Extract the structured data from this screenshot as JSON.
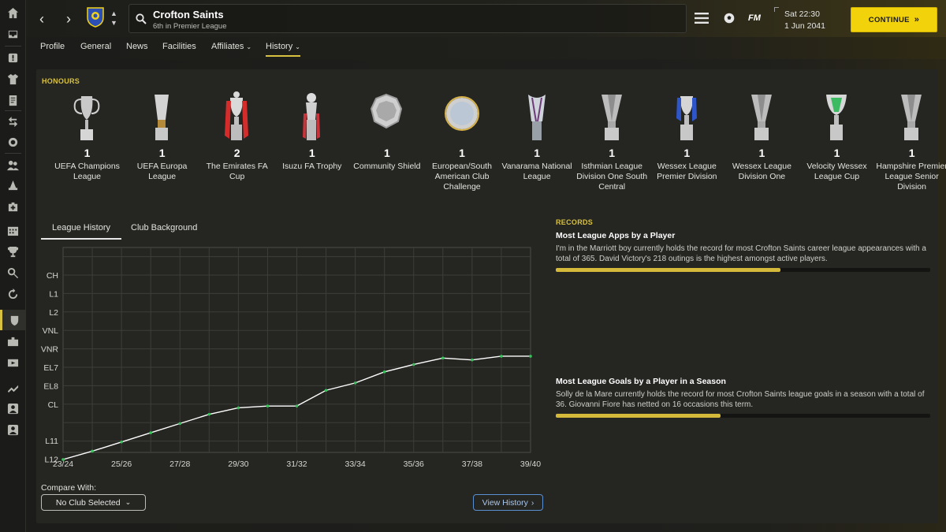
{
  "sidebar": {
    "icons": [
      "home-icon",
      "inbox-icon",
      "alert-icon",
      "squad-icon",
      "tactics-icon",
      "transfers-icon",
      "scouting-icon",
      "staff-icon",
      "training-icon",
      "medical-icon",
      "schedule-icon",
      "competitions-icon",
      "search-icon",
      "refresh-icon",
      "club-icon",
      "finances-icon",
      "media-icon",
      "development-icon",
      "team-report-icon",
      "reserves-icon"
    ]
  },
  "topbar": {
    "club_name": "Crofton Saints",
    "club_position": "6th in Premier League",
    "fm_logo": "FM",
    "day_time": "Sat 22:30",
    "date": "1 Jun 2041",
    "continue_label": "CONTINUE",
    "continue_chevron": "»"
  },
  "tabs": [
    {
      "label": "Profile"
    },
    {
      "label": "General"
    },
    {
      "label": "News"
    },
    {
      "label": "Facilities"
    },
    {
      "label": "Affiliates",
      "has_caret": true
    },
    {
      "label": "History",
      "has_caret": true,
      "active": true
    }
  ],
  "honours": {
    "title": "HONOURS",
    "items": [
      {
        "count": "1",
        "name": "UEFA Champions League",
        "trophy": "cup-big-ears"
      },
      {
        "count": "1",
        "name": "UEFA Europa League",
        "trophy": "cup-europa"
      },
      {
        "count": "2",
        "name": "The Emirates FA Cup",
        "trophy": "cup-fa-ribbons"
      },
      {
        "count": "1",
        "name": "Isuzu FA Trophy",
        "trophy": "cup-ribbons-small"
      },
      {
        "count": "1",
        "name": "Community Shield",
        "trophy": "shield-plate"
      },
      {
        "count": "1",
        "name": "European/South American Club Challenge",
        "trophy": "round-plate"
      },
      {
        "count": "1",
        "name": "Vanarama National League",
        "trophy": "cup-modern-tall"
      },
      {
        "count": "1",
        "name": "Isthmian League Division One South Central",
        "trophy": "cup-generic"
      },
      {
        "count": "1",
        "name": "Wessex League Premier Division",
        "trophy": "cup-blue-ribbons"
      },
      {
        "count": "1",
        "name": "Wessex League Division One",
        "trophy": "cup-generic"
      },
      {
        "count": "1",
        "name": "Velocity Wessex League Cup",
        "trophy": "cup-green"
      },
      {
        "count": "1",
        "name": "Hampshire Premier League Senior Division",
        "trophy": "cup-generic"
      }
    ]
  },
  "chart_tabs": {
    "league_history": "League History",
    "club_background": "Club Background"
  },
  "chart_data": {
    "type": "line",
    "x_ticks": [
      "23/24",
      "25/26",
      "27/28",
      "29/30",
      "31/32",
      "33/34",
      "35/36",
      "37/38",
      "39/40"
    ],
    "y_ticks": [
      "CH",
      "L1",
      "L2",
      "VNL",
      "VNR",
      "EL7",
      "EL8",
      "CL",
      "L11",
      "L12"
    ],
    "x": [
      "23/24",
      "24/25",
      "25/26",
      "26/27",
      "27/28",
      "28/29",
      "29/30",
      "30/31",
      "31/32",
      "32/33",
      "33/34",
      "34/35",
      "35/36",
      "36/37",
      "37/38",
      "38/39",
      "39/40"
    ],
    "y_position_index": [
      10.0,
      9.55,
      9.05,
      8.55,
      8.05,
      7.55,
      7.2,
      7.1,
      7.1,
      6.25,
      5.85,
      5.25,
      4.85,
      4.5,
      4.6,
      4.4,
      4.4
    ],
    "y_position_note": "index on tick scale: 0=CH ... 9=L12, 10 = bottom edge; values above 0 are above CH (top-flight positions)",
    "grid": true,
    "color": "#ffffff",
    "point_color": "#37c45a"
  },
  "compare": {
    "label": "Compare With:",
    "selected": "No Club Selected"
  },
  "view_history_label": "View History",
  "records": {
    "title": "RECORDS",
    "items": [
      {
        "title": "Most League Apps by a Player",
        "description": "I'm in the Marriott boy currently holds the record for most Crofton Saints career league appearances with a total of 365. David Victory's 218 outings is the highest amongst active players.",
        "progress": 0.6
      },
      {
        "title": "Most League Goals by a Player in a Season",
        "description": "Solly de la Mare currently holds the record for most Crofton Saints league goals in a season with a total of 36. Giovanni Fiore has netted on 16 occasions this term.",
        "progress": 0.44
      }
    ]
  }
}
